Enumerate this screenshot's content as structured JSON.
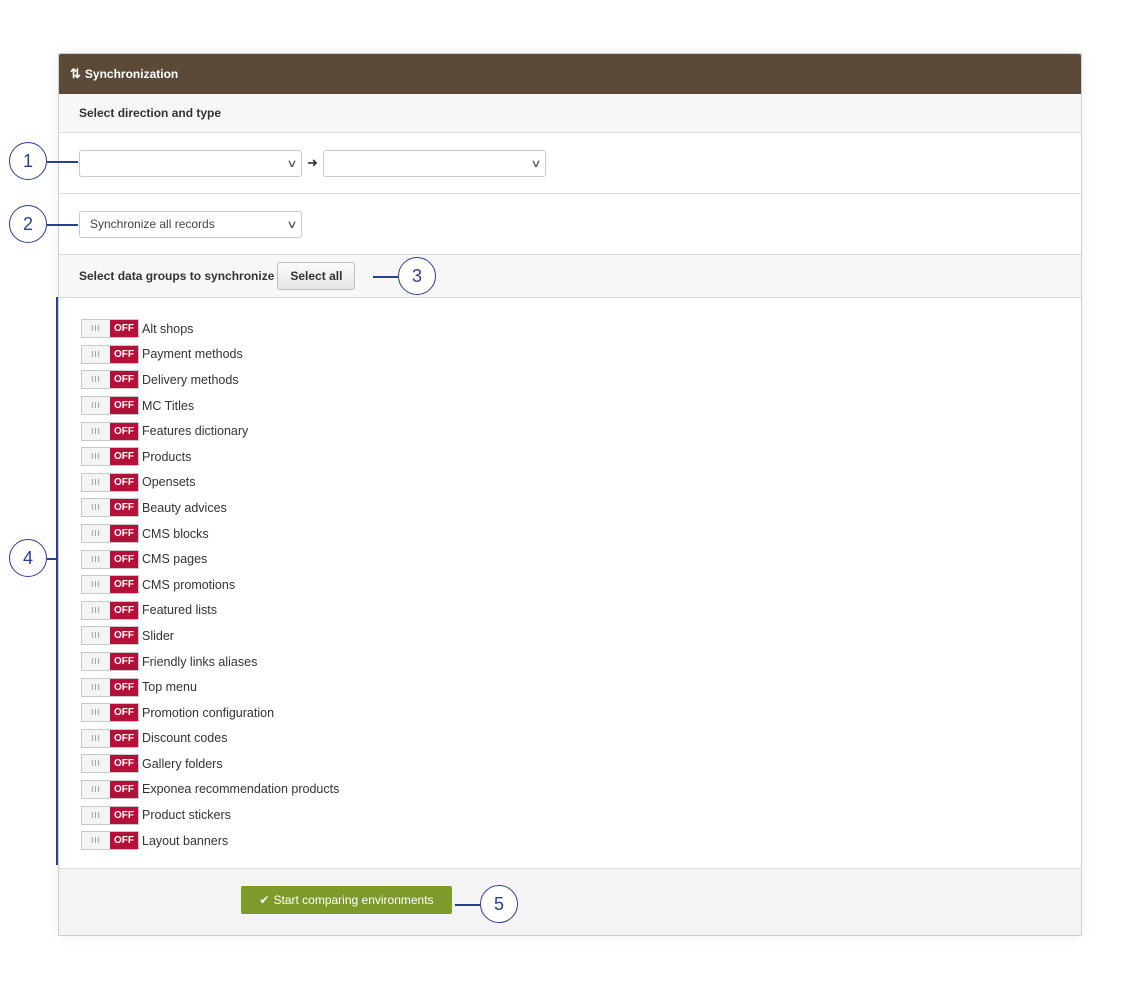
{
  "header": {
    "title": "Synchronization",
    "icon": "sync-icon"
  },
  "direction": {
    "title": "Select direction and type",
    "source_value": "",
    "target_value": ""
  },
  "sync_type": {
    "value": "Synchronize all records"
  },
  "groups": {
    "title": "Select data groups to synchronize",
    "select_all_label": "Select all",
    "toggle_off_label": "OFF",
    "toggle_knob": "III",
    "items": [
      {
        "label": "Alt shops"
      },
      {
        "label": "Payment methods"
      },
      {
        "label": "Delivery methods"
      },
      {
        "label": "MC Titles"
      },
      {
        "label": "Features dictionary"
      },
      {
        "label": "Products"
      },
      {
        "label": "Opensets"
      },
      {
        "label": "Beauty advices"
      },
      {
        "label": "CMS blocks"
      },
      {
        "label": "CMS pages"
      },
      {
        "label": "CMS promotions"
      },
      {
        "label": "Featured lists"
      },
      {
        "label": "Slider"
      },
      {
        "label": "Friendly links aliases"
      },
      {
        "label": "Top menu"
      },
      {
        "label": "Promotion configuration"
      },
      {
        "label": "Discount codes"
      },
      {
        "label": "Gallery folders"
      },
      {
        "label": "Exponea recommendation products"
      },
      {
        "label": "Product stickers"
      },
      {
        "label": "Layout banners"
      }
    ]
  },
  "footer": {
    "start_label": "Start comparing environments"
  },
  "callouts": [
    "1",
    "2",
    "3",
    "4",
    "5"
  ],
  "colors": {
    "header": "#5b4a37",
    "toggle_off": "#b5103a",
    "start_button": "#7d9a2b",
    "callout": "#2b3f8f"
  }
}
